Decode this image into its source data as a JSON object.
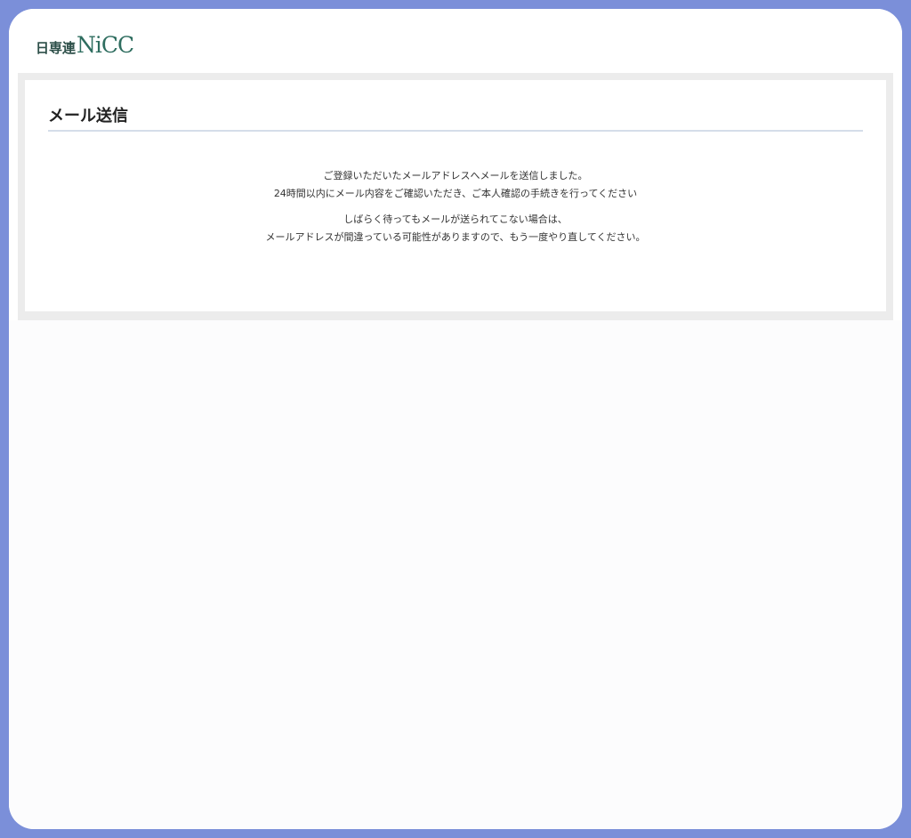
{
  "header": {
    "logo_kanji": "日専連",
    "logo_latin": "NiCC"
  },
  "panel": {
    "title": "メール送信",
    "messages": [
      {
        "lines": [
          "ご登録いただいたメールアドレスへメールを送信しました。",
          "24時間以内にメール内容をご確認いただき、ご本人確認の手続きを行ってください"
        ]
      },
      {
        "lines": [
          "しばらく待ってもメールが送られてこない場合は、",
          "メールアドレスが間違っている可能性がありますので、もう一度やり直してください。"
        ]
      }
    ]
  },
  "colors": {
    "frame_border": "#7b8fd9",
    "panel_border": "#ececec",
    "title_rule": "#d5dde9",
    "logo": "#2e6d5f"
  }
}
